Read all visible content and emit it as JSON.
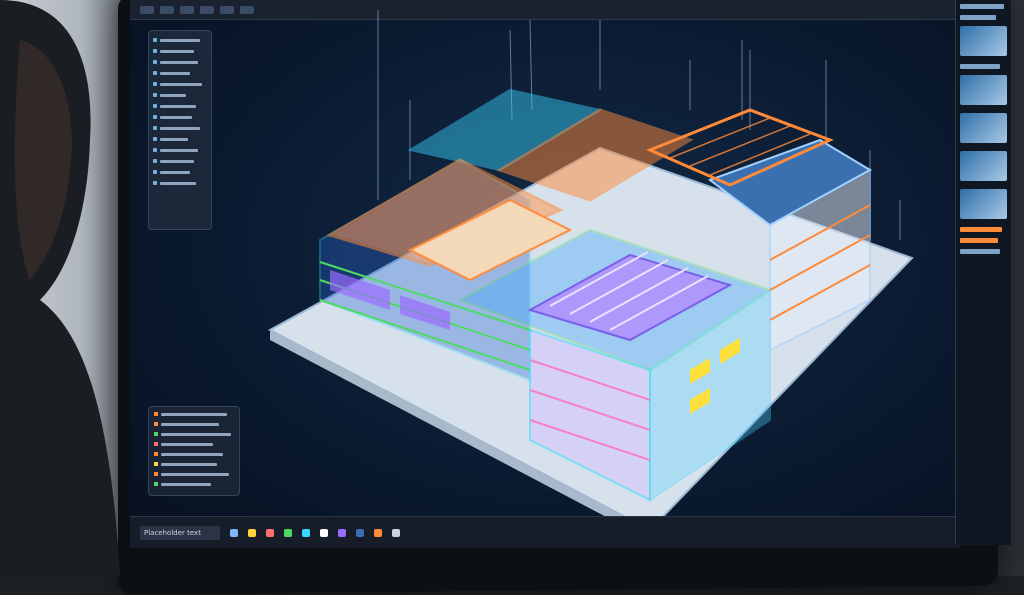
{
  "scene": {
    "subject": "bim-3d-building-model-on-monitor"
  },
  "ui": {
    "taskbar_search_text": "Placeholder text"
  },
  "colors": {
    "screen_bg": "#0b1a30",
    "structure_cyan": "#38d7ff",
    "structure_orange": "#ff8a3a",
    "structure_green": "#4cd964",
    "structure_purple": "#9b6bff",
    "structure_pink": "#ff6fb5",
    "roof_blue": "#3a6fb0",
    "slab": "#dfe6ef"
  }
}
